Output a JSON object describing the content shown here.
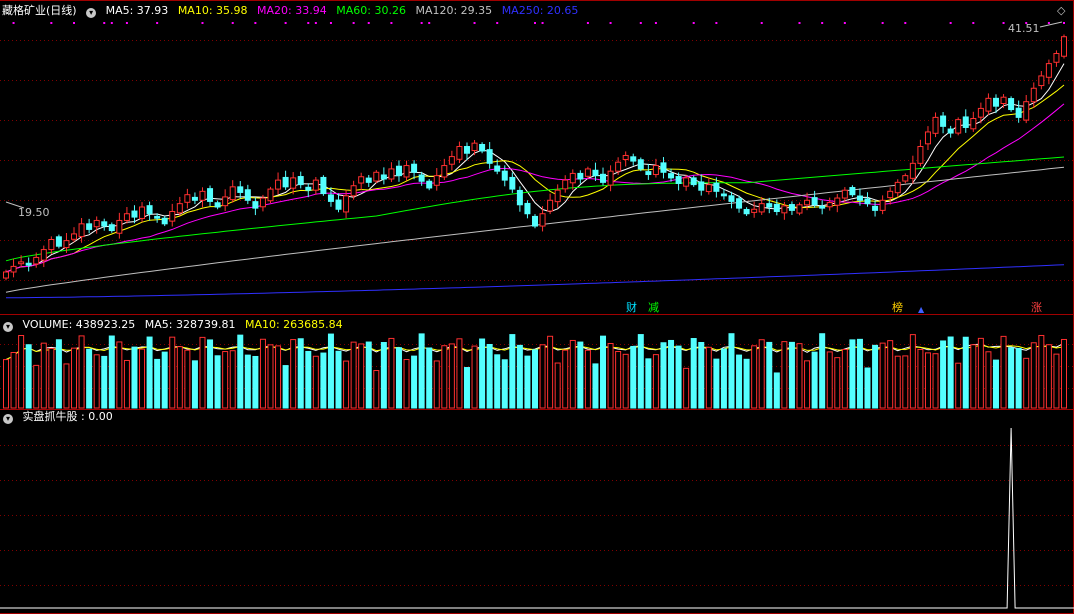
{
  "header": {
    "stock_name": "藏格矿业(日线)",
    "ma": [
      {
        "label": "MA5: 37.93",
        "color": "#ffffff"
      },
      {
        "label": "MA10: 35.98",
        "color": "#ffff00"
      },
      {
        "label": "MA20: 33.94",
        "color": "#ff00ff"
      },
      {
        "label": "MA60: 30.26",
        "color": "#00ff00"
      },
      {
        "label": "MA120: 29.35",
        "color": "#c0c0c0"
      },
      {
        "label": "MA250: 20.65",
        "color": "#3030ff"
      }
    ]
  },
  "volume_header": {
    "label": "VOLUME: 438923.25",
    "ma5": "MA5: 328739.81",
    "ma10": "MA10: 263685.84"
  },
  "indicator_header": {
    "label": "实盘抓牛股 : 0.00"
  },
  "tags": [
    {
      "text": "财",
      "color": "#00e0ff"
    },
    {
      "text": "减",
      "color": "#00ff00"
    },
    {
      "text": "榜",
      "color": "#ffd000"
    },
    {
      "text": "▲",
      "color": "#4060ff"
    },
    {
      "text": "涨",
      "color": "#ff4040"
    }
  ],
  "price_labels": {
    "high": "41.51",
    "low": "19.50"
  },
  "colors": {
    "up": "#ff3030",
    "down": "#54ffff",
    "grid": "#800000",
    "ma5": "#ffffff",
    "ma10": "#ffff00",
    "ma20": "#ff00ff",
    "ma60": "#00ff00",
    "ma120": "#c0c0c0",
    "ma250": "#3030ff"
  },
  "chart_data": {
    "type": "candlestick",
    "price_range": [
      19.5,
      41.51
    ],
    "ma_latest": {
      "MA5": 37.93,
      "MA10": 35.98,
      "MA20": 33.94,
      "MA60": 30.26,
      "MA120": 29.35,
      "MA250": 20.65
    },
    "volume_latest": 438923.25,
    "volume_ma5": 328739.81,
    "volume_ma10": 263685.84,
    "indicator_name": "实盘抓牛股",
    "indicator_latest": 0.0,
    "indicator_spike_index": 133,
    "close": [
      20.0,
      20.5,
      20.9,
      20.6,
      21.3,
      22.0,
      22.9,
      22.3,
      22.8,
      23.4,
      24.3,
      23.8,
      24.6,
      24.1,
      23.7,
      24.6,
      25.2,
      24.9,
      25.8,
      25.2,
      24.8,
      24.3,
      25.4,
      26.1,
      26.9,
      26.4,
      27.2,
      26.3,
      25.8,
      26.7,
      27.6,
      27.1,
      26.4,
      25.7,
      26.6,
      27.4,
      28.2,
      27.6,
      28.4,
      27.8,
      27.3,
      28.2,
      27.0,
      26.3,
      25.6,
      26.8,
      27.7,
      28.5,
      28.0,
      28.9,
      28.3,
      29.2,
      28.6,
      29.5,
      28.9,
      28.1,
      27.5,
      28.6,
      29.5,
      30.3,
      31.2,
      30.6,
      31.5,
      30.8,
      29.7,
      29.0,
      28.2,
      27.4,
      26.0,
      25.2,
      24.1,
      25.2,
      26.4,
      27.3,
      28.2,
      28.8,
      28.3,
      29.2,
      28.6,
      28.0,
      29.0,
      29.8,
      30.4,
      29.9,
      29.2,
      28.7,
      29.5,
      28.9,
      28.4,
      27.9,
      28.4,
      27.8,
      27.3,
      27.8,
      27.2,
      26.8,
      26.3,
      25.7,
      25.2,
      25.6,
      26.1,
      25.8,
      25.4,
      25.9,
      25.5,
      26.0,
      26.4,
      26.0,
      25.7,
      26.2,
      26.6,
      27.3,
      26.9,
      26.4,
      26.1,
      25.5,
      26.4,
      27.2,
      28.0,
      28.6,
      29.7,
      31.2,
      32.5,
      33.8,
      33.0,
      32.4,
      33.6,
      32.9,
      33.7,
      34.6,
      35.5,
      34.8,
      35.6,
      34.5,
      33.8,
      35.2,
      36.4,
      37.5,
      38.6,
      39.5,
      41.0
    ]
  }
}
